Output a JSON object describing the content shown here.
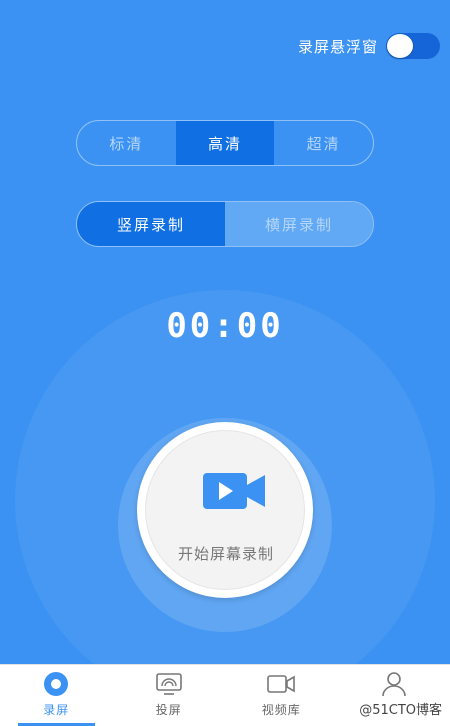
{
  "float_window": {
    "label": "录屏悬浮窗",
    "enabled": true
  },
  "quality": {
    "options": [
      "标清",
      "高清",
      "超清"
    ],
    "selected": "高清"
  },
  "orientation": {
    "options": [
      "竖屏录制",
      "横屏录制"
    ],
    "selected": "竖屏录制"
  },
  "timer": "00:00",
  "record_button": {
    "label": "开始屏幕录制",
    "icon": "video-camera-icon"
  },
  "nav": {
    "items": [
      {
        "label": "录屏",
        "icon": "record-icon",
        "active": true
      },
      {
        "label": "投屏",
        "icon": "cast-screen-icon",
        "active": false
      },
      {
        "label": "视频库",
        "icon": "video-library-icon",
        "active": false
      },
      {
        "label": "",
        "icon": "profile-icon",
        "active": false
      }
    ]
  },
  "watermark": "@51CTO博客",
  "colors": {
    "background": "#3b92f2",
    "accent_dark": "#0f6fe3",
    "nav_active": "#3b92f2"
  }
}
